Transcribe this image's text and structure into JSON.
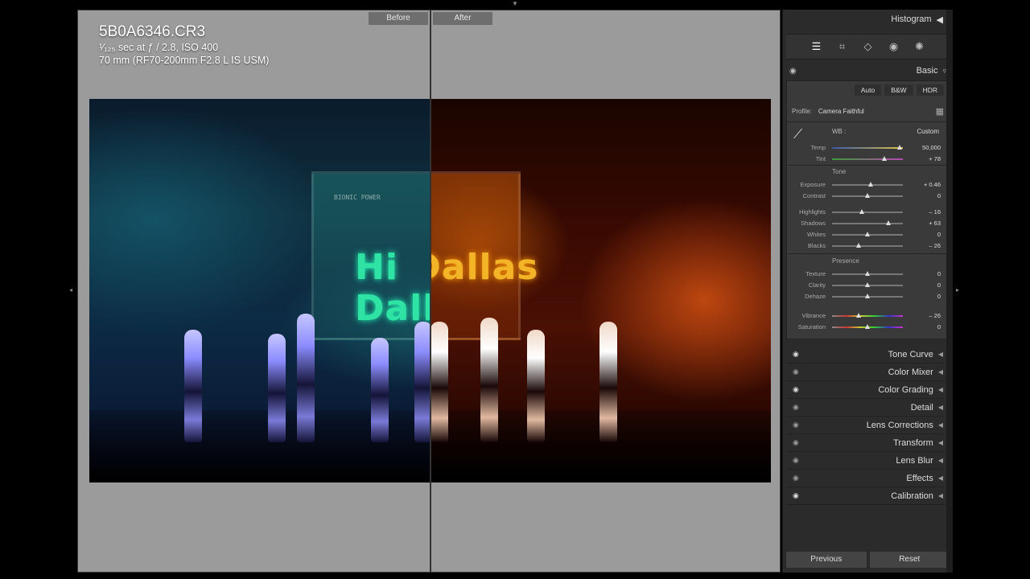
{
  "view": {
    "before_label": "Before",
    "after_label": "After",
    "file_name": "5B0A6346.CR3",
    "exposure_line": "¹⁄₁₂₅ sec at ƒ / 2.8, ISO 400",
    "lens_line": "70 mm (RF70-200mm F2.8 L IS USM)",
    "screen_title": "Hi Dallas",
    "screen_subtitle": "BIONIC POWER"
  },
  "panel": {
    "histogram_label": "Histogram",
    "basic_label": "Basic",
    "tools": [
      "sliders-icon",
      "crop-icon",
      "eraser-icon",
      "redeye-icon",
      "masking-icon"
    ],
    "buttons": {
      "auto": "Auto",
      "bw": "B&W",
      "hdr": "HDR"
    },
    "profile_label": "Profile:",
    "profile_value": "Camera Faithful",
    "wb_label": "WB :",
    "wb_value": "Custom",
    "tone_label": "Tone",
    "presence_label": "Presence",
    "sliders": {
      "temp": {
        "label": "Temp",
        "value": "50,000",
        "pos": 0.96
      },
      "tint": {
        "label": "Tint",
        "value": "+ 78",
        "pos": 0.74
      },
      "exposure": {
        "label": "Exposure",
        "value": "+ 0.46",
        "pos": 0.55
      },
      "contrast": {
        "label": "Contrast",
        "value": "0",
        "pos": 0.5
      },
      "highlights": {
        "label": "Highlights",
        "value": "– 16",
        "pos": 0.42
      },
      "shadows": {
        "label": "Shadows",
        "value": "+ 63",
        "pos": 0.8
      },
      "whites": {
        "label": "Whites",
        "value": "0",
        "pos": 0.5
      },
      "blacks": {
        "label": "Blacks",
        "value": "– 26",
        "pos": 0.37
      },
      "texture": {
        "label": "Texture",
        "value": "0",
        "pos": 0.5
      },
      "clarity": {
        "label": "Clarity",
        "value": "0",
        "pos": 0.5
      },
      "dehaze": {
        "label": "Dehaze",
        "value": "0",
        "pos": 0.5
      },
      "vibrance": {
        "label": "Vibrance",
        "value": "– 26",
        "pos": 0.37
      },
      "saturation": {
        "label": "Saturation",
        "value": "0",
        "pos": 0.5
      }
    },
    "groups": [
      {
        "label": "Tone Curve",
        "visible": true
      },
      {
        "label": "Color Mixer",
        "visible": false
      },
      {
        "label": "Color Grading",
        "visible": true
      },
      {
        "label": "Detail",
        "visible": false
      },
      {
        "label": "Lens Corrections",
        "visible": false
      },
      {
        "label": "Transform",
        "visible": false
      },
      {
        "label": "Lens Blur",
        "visible": false
      },
      {
        "label": "Effects",
        "visible": false
      },
      {
        "label": "Calibration",
        "visible": true
      }
    ],
    "previous_label": "Previous",
    "reset_label": "Reset"
  }
}
